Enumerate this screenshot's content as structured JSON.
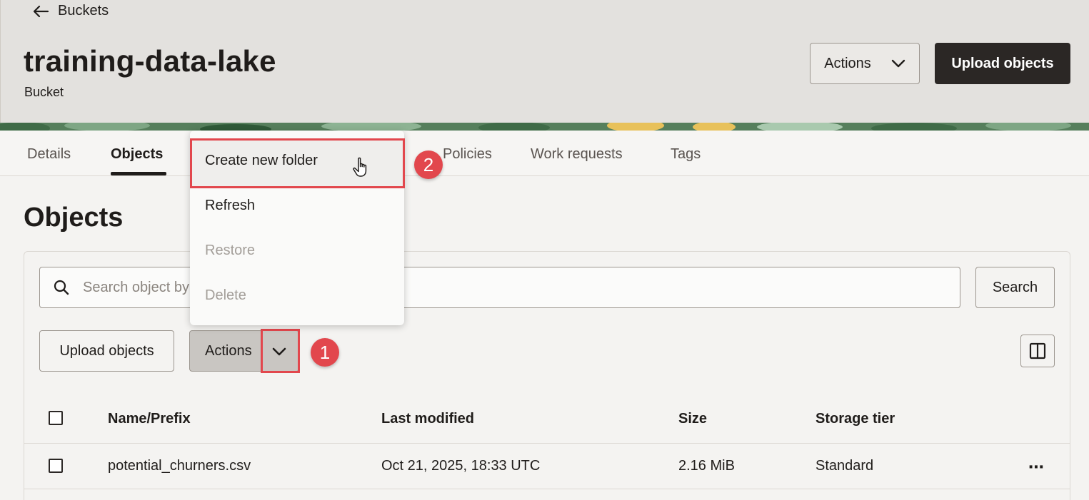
{
  "header": {
    "back_label": "Buckets",
    "title": "training-data-lake",
    "subtitle": "Bucket",
    "actions_label": "Actions",
    "upload_label": "Upload objects"
  },
  "tabs": [
    {
      "label": "Details"
    },
    {
      "label": "Objects"
    },
    {
      "label": "Policies"
    },
    {
      "label": "Work requests"
    },
    {
      "label": "Tags"
    }
  ],
  "section_title": "Objects",
  "search": {
    "placeholder": "Search object by",
    "button_label": "Search"
  },
  "toolbar": {
    "upload_label": "Upload objects",
    "actions_label": "Actions"
  },
  "actions_menu": {
    "items": [
      {
        "label": "Create new folder",
        "enabled": true
      },
      {
        "label": "Refresh",
        "enabled": true
      },
      {
        "label": "Restore",
        "enabled": false
      },
      {
        "label": "Delete",
        "enabled": false
      }
    ]
  },
  "callouts": {
    "step1": "1",
    "step2": "2"
  },
  "table": {
    "columns": [
      "Name/Prefix",
      "Last modified",
      "Size",
      "Storage tier"
    ],
    "rows": [
      {
        "name": "potential_churners.csv",
        "modified": "Oct 21, 2025, 18:33 UTC",
        "size": "2.16 MiB",
        "tier": "Standard",
        "more": "⋯"
      }
    ]
  },
  "colors": {
    "accent_red": "#e2474d",
    "dark_button": "#2b2725"
  }
}
